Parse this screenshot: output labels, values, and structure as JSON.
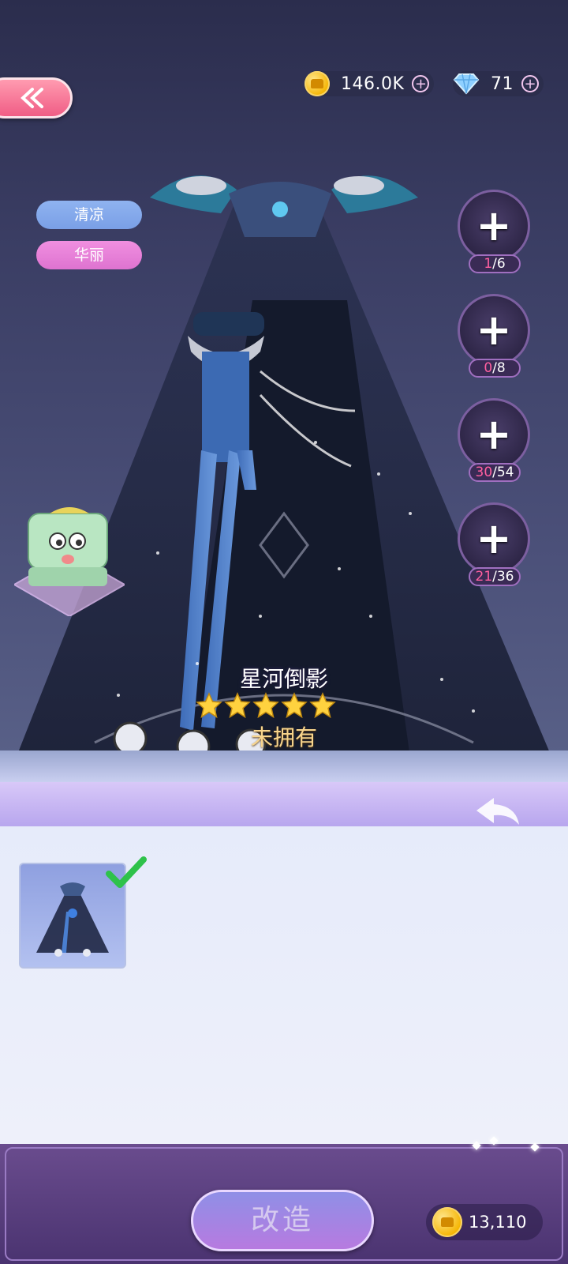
{
  "header": {
    "back_icon": "double-chevron-left-icon",
    "gold": {
      "icon": "gold-coin-icon",
      "value": "146.0K",
      "add_icon": "plus-circle-icon"
    },
    "diamond": {
      "icon": "diamond-icon",
      "value": "71",
      "add_icon": "plus-circle-icon"
    }
  },
  "tags": [
    {
      "label": "清凉",
      "color": "#8fb3f0"
    },
    {
      "label": "华丽",
      "color": "#e27fd6"
    }
  ],
  "materials": [
    {
      "have": "1",
      "need": "/6",
      "icon": "outfit-figure-icon"
    },
    {
      "have": "0",
      "need": "/8",
      "icon": "green-outfit-icon"
    },
    {
      "have": "30",
      "need": "/54",
      "icon": "fabric-stack-icon"
    },
    {
      "have": "21",
      "need": "/36",
      "icon": "red-leather-icon"
    }
  ],
  "outfit": {
    "name": "星河倒影",
    "stars": 5,
    "status": "未拥有"
  },
  "panel": {
    "undo_icon": "undo-arrow-icon",
    "items": [
      {
        "icon": "outfit-thumbnail-icon",
        "selected": true
      }
    ]
  },
  "footer": {
    "craft_label": "改造",
    "cost": {
      "icon": "gold-coin-icon",
      "value": "13,110"
    }
  }
}
